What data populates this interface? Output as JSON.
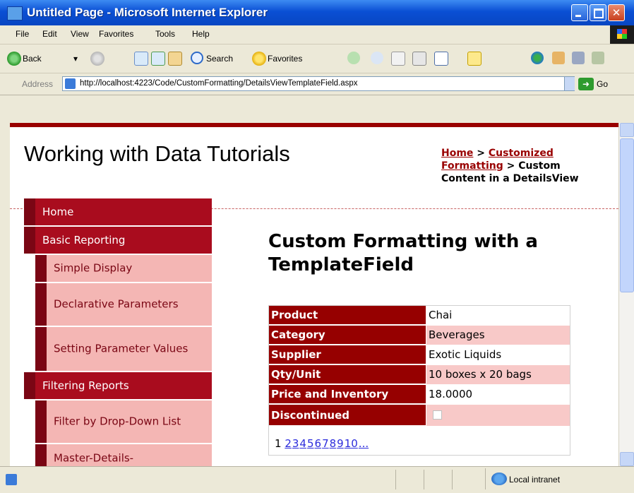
{
  "window": {
    "title": "Untitled Page - Microsoft Internet Explorer",
    "controls": {
      "minimize": "",
      "maximize": "",
      "close": "✕"
    }
  },
  "menubar": {
    "items": [
      {
        "label": "File"
      },
      {
        "label": "Edit"
      },
      {
        "label": "View"
      },
      {
        "label": "Favorites"
      },
      {
        "label": "Tools"
      },
      {
        "label": "Help"
      }
    ]
  },
  "toolbar": {
    "back_label": "Back",
    "search_label": "Search",
    "favorites_label": "Favorites"
  },
  "address": {
    "label": "Address",
    "url": "http://localhost:4223/Code/CustomFormatting/DetailsViewTemplateField.aspx",
    "go_label": "Go"
  },
  "page": {
    "site_title": "Working with Data Tutorials",
    "breadcrumb": {
      "link1": "Home",
      "sep1": " > ",
      "link2": "Customized Formatting",
      "sep2": " > ",
      "current": "Custom Content in a DetailsView"
    },
    "menu": {
      "items": [
        {
          "label": "Home",
          "level": "top"
        },
        {
          "label": "Basic Reporting",
          "level": "top"
        },
        {
          "label": "Simple Display",
          "level": "sub"
        },
        {
          "label": "Declarative Parameters",
          "level": "sub"
        },
        {
          "label": "Setting Parameter Values",
          "level": "sub"
        },
        {
          "label": "Filtering Reports",
          "level": "top"
        },
        {
          "label": "Filter by Drop-Down List",
          "level": "sub"
        },
        {
          "label": "Master-Details-",
          "level": "sub"
        }
      ]
    },
    "heading": "Custom Formatting with a TemplateField",
    "details": {
      "rows": [
        {
          "header": "Product",
          "value": "Chai"
        },
        {
          "header": "Category",
          "value": "Beverages"
        },
        {
          "header": "Supplier",
          "value": "Exotic Liquids"
        },
        {
          "header": "Qty/Unit",
          "value": "10 boxes x 20 bags"
        },
        {
          "header": "Price and Inventory",
          "value": "18.0000"
        },
        {
          "header": "Discontinued",
          "value": ""
        }
      ],
      "discontinued_checked": false,
      "pager": {
        "current": "1",
        "links": [
          "2",
          "3",
          "4",
          "5",
          "6",
          "7",
          "8",
          "9",
          "10",
          "..."
        ]
      }
    }
  },
  "statusbar": {
    "zone": "Local intranet"
  },
  "colors": {
    "accent": "#990000",
    "header_row": "#960000",
    "alt_row": "#f8c9c8",
    "menu_top": "#a90c1e",
    "menu_sub": "#f4b6b4",
    "link": "#2b2bdc"
  }
}
